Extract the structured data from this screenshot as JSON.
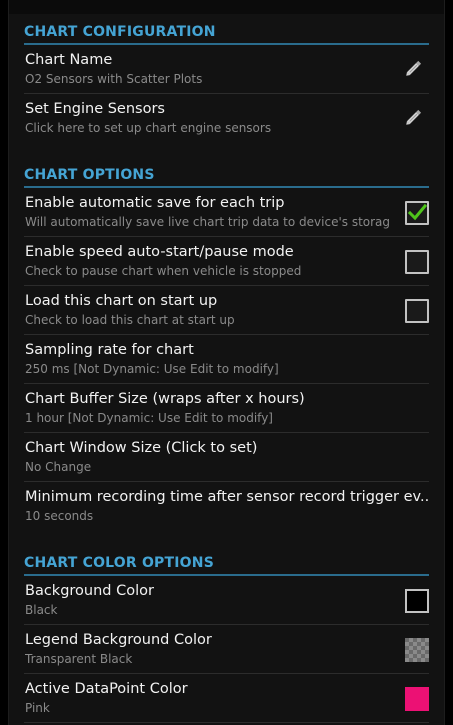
{
  "sections": {
    "configuration": {
      "header": "CHART CONFIGURATION",
      "chart_name": {
        "title": "Chart Name",
        "summary": "O2 Sensors with Scatter Plots",
        "icon": "pencil-icon"
      },
      "engine_sensors": {
        "title": "Set Engine Sensors",
        "summary": "Click here to set up chart engine sensors",
        "icon": "pencil-icon"
      }
    },
    "options": {
      "header": "CHART OPTIONS",
      "auto_save": {
        "title": "Enable automatic save for each trip",
        "summary": "Will automatically save live chart trip data to device's storage.",
        "checked": true
      },
      "speed_auto_start": {
        "title": "Enable speed auto-start/pause mode",
        "summary": "Check to pause chart when vehicle is stopped",
        "checked": false
      },
      "load_on_startup": {
        "title": "Load this chart on start up",
        "summary": "Check to load this chart at start up",
        "checked": false
      },
      "sampling_rate": {
        "title": "Sampling rate for chart",
        "summary": "250 ms [Not Dynamic: Use Edit to modify]"
      },
      "buffer_size": {
        "title": "Chart Buffer Size (wraps after x hours)",
        "summary": "1 hour [Not Dynamic: Use Edit to modify]"
      },
      "window_size": {
        "title": "Chart Window Size (Click to set)",
        "summary": "No Change"
      },
      "min_recording": {
        "title": "Minimum recording time after sensor record trigger ev..",
        "summary": "10 seconds"
      }
    },
    "color_options": {
      "header": "CHART COLOR OPTIONS",
      "background": {
        "title": "Background Color",
        "summary": "Black",
        "color": "#000000"
      },
      "legend_background": {
        "title": "Legend Background Color",
        "summary": "Transparent Black",
        "color": "transparent-black"
      },
      "active_datapoint": {
        "title": "Active DataPoint Color",
        "summary": "Pink",
        "color": "#ec1174"
      }
    }
  },
  "theme": {
    "accent": "#45a4d4",
    "divider_accent": "#2a6c8d",
    "check_green": "#4fc51b"
  }
}
